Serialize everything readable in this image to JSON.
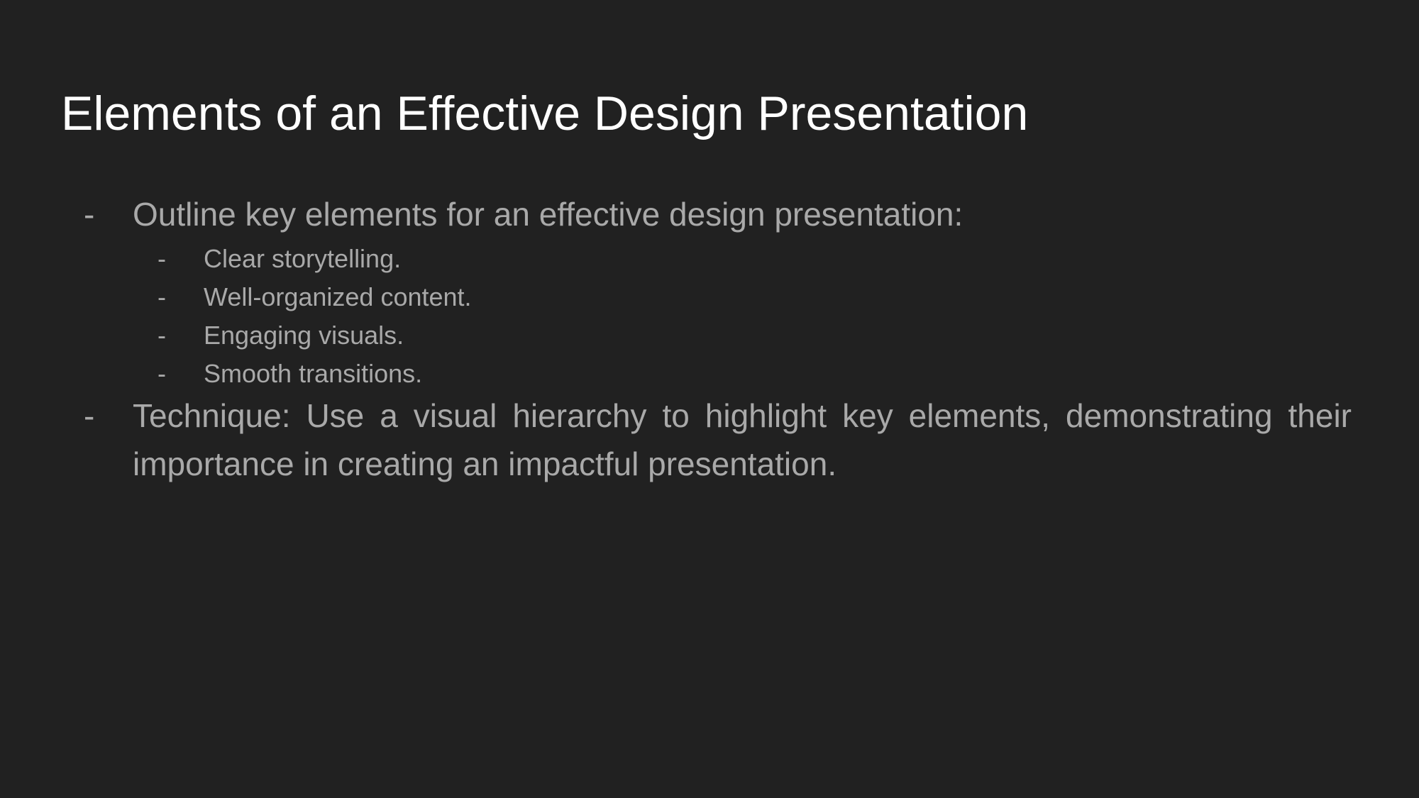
{
  "slide": {
    "title": "Elements of an Effective Design Presentation",
    "bullets": [
      {
        "marker": "-",
        "text": "Outline key elements for an effective design presentation:",
        "subitems": [
          {
            "marker": "-",
            "text": "Clear storytelling."
          },
          {
            "marker": "-",
            "text": "Well-organized content."
          },
          {
            "marker": "-",
            "text": "Engaging visuals."
          },
          {
            "marker": "-",
            "text": "Smooth transitions."
          }
        ]
      },
      {
        "marker": "-",
        "text": "Technique: Use a visual hierarchy to highlight key elements, demonstrating their importance in creating an impactful presentation."
      }
    ]
  },
  "colors": {
    "background": "#212121",
    "title": "#ffffff",
    "body_text": "#a9a9a9"
  }
}
